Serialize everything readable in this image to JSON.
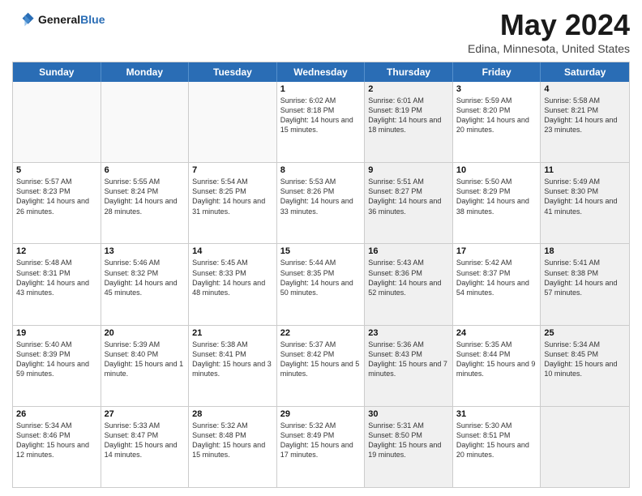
{
  "header": {
    "logo_general": "General",
    "logo_blue": "Blue",
    "month_title": "May 2024",
    "location": "Edina, Minnesota, United States"
  },
  "days_of_week": [
    "Sunday",
    "Monday",
    "Tuesday",
    "Wednesday",
    "Thursday",
    "Friday",
    "Saturday"
  ],
  "weeks": [
    [
      {
        "day": "",
        "sunrise": "",
        "sunset": "",
        "daylight": "",
        "shaded": false,
        "empty": true
      },
      {
        "day": "",
        "sunrise": "",
        "sunset": "",
        "daylight": "",
        "shaded": false,
        "empty": true
      },
      {
        "day": "",
        "sunrise": "",
        "sunset": "",
        "daylight": "",
        "shaded": false,
        "empty": true
      },
      {
        "day": "1",
        "sunrise": "Sunrise: 6:02 AM",
        "sunset": "Sunset: 8:18 PM",
        "daylight": "Daylight: 14 hours and 15 minutes.",
        "shaded": false,
        "empty": false
      },
      {
        "day": "2",
        "sunrise": "Sunrise: 6:01 AM",
        "sunset": "Sunset: 8:19 PM",
        "daylight": "Daylight: 14 hours and 18 minutes.",
        "shaded": true,
        "empty": false
      },
      {
        "day": "3",
        "sunrise": "Sunrise: 5:59 AM",
        "sunset": "Sunset: 8:20 PM",
        "daylight": "Daylight: 14 hours and 20 minutes.",
        "shaded": false,
        "empty": false
      },
      {
        "day": "4",
        "sunrise": "Sunrise: 5:58 AM",
        "sunset": "Sunset: 8:21 PM",
        "daylight": "Daylight: 14 hours and 23 minutes.",
        "shaded": true,
        "empty": false
      }
    ],
    [
      {
        "day": "5",
        "sunrise": "Sunrise: 5:57 AM",
        "sunset": "Sunset: 8:23 PM",
        "daylight": "Daylight: 14 hours and 26 minutes.",
        "shaded": false,
        "empty": false
      },
      {
        "day": "6",
        "sunrise": "Sunrise: 5:55 AM",
        "sunset": "Sunset: 8:24 PM",
        "daylight": "Daylight: 14 hours and 28 minutes.",
        "shaded": false,
        "empty": false
      },
      {
        "day": "7",
        "sunrise": "Sunrise: 5:54 AM",
        "sunset": "Sunset: 8:25 PM",
        "daylight": "Daylight: 14 hours and 31 minutes.",
        "shaded": false,
        "empty": false
      },
      {
        "day": "8",
        "sunrise": "Sunrise: 5:53 AM",
        "sunset": "Sunset: 8:26 PM",
        "daylight": "Daylight: 14 hours and 33 minutes.",
        "shaded": false,
        "empty": false
      },
      {
        "day": "9",
        "sunrise": "Sunrise: 5:51 AM",
        "sunset": "Sunset: 8:27 PM",
        "daylight": "Daylight: 14 hours and 36 minutes.",
        "shaded": true,
        "empty": false
      },
      {
        "day": "10",
        "sunrise": "Sunrise: 5:50 AM",
        "sunset": "Sunset: 8:29 PM",
        "daylight": "Daylight: 14 hours and 38 minutes.",
        "shaded": false,
        "empty": false
      },
      {
        "day": "11",
        "sunrise": "Sunrise: 5:49 AM",
        "sunset": "Sunset: 8:30 PM",
        "daylight": "Daylight: 14 hours and 41 minutes.",
        "shaded": true,
        "empty": false
      }
    ],
    [
      {
        "day": "12",
        "sunrise": "Sunrise: 5:48 AM",
        "sunset": "Sunset: 8:31 PM",
        "daylight": "Daylight: 14 hours and 43 minutes.",
        "shaded": false,
        "empty": false
      },
      {
        "day": "13",
        "sunrise": "Sunrise: 5:46 AM",
        "sunset": "Sunset: 8:32 PM",
        "daylight": "Daylight: 14 hours and 45 minutes.",
        "shaded": false,
        "empty": false
      },
      {
        "day": "14",
        "sunrise": "Sunrise: 5:45 AM",
        "sunset": "Sunset: 8:33 PM",
        "daylight": "Daylight: 14 hours and 48 minutes.",
        "shaded": false,
        "empty": false
      },
      {
        "day": "15",
        "sunrise": "Sunrise: 5:44 AM",
        "sunset": "Sunset: 8:35 PM",
        "daylight": "Daylight: 14 hours and 50 minutes.",
        "shaded": false,
        "empty": false
      },
      {
        "day": "16",
        "sunrise": "Sunrise: 5:43 AM",
        "sunset": "Sunset: 8:36 PM",
        "daylight": "Daylight: 14 hours and 52 minutes.",
        "shaded": true,
        "empty": false
      },
      {
        "day": "17",
        "sunrise": "Sunrise: 5:42 AM",
        "sunset": "Sunset: 8:37 PM",
        "daylight": "Daylight: 14 hours and 54 minutes.",
        "shaded": false,
        "empty": false
      },
      {
        "day": "18",
        "sunrise": "Sunrise: 5:41 AM",
        "sunset": "Sunset: 8:38 PM",
        "daylight": "Daylight: 14 hours and 57 minutes.",
        "shaded": true,
        "empty": false
      }
    ],
    [
      {
        "day": "19",
        "sunrise": "Sunrise: 5:40 AM",
        "sunset": "Sunset: 8:39 PM",
        "daylight": "Daylight: 14 hours and 59 minutes.",
        "shaded": false,
        "empty": false
      },
      {
        "day": "20",
        "sunrise": "Sunrise: 5:39 AM",
        "sunset": "Sunset: 8:40 PM",
        "daylight": "Daylight: 15 hours and 1 minute.",
        "shaded": false,
        "empty": false
      },
      {
        "day": "21",
        "sunrise": "Sunrise: 5:38 AM",
        "sunset": "Sunset: 8:41 PM",
        "daylight": "Daylight: 15 hours and 3 minutes.",
        "shaded": false,
        "empty": false
      },
      {
        "day": "22",
        "sunrise": "Sunrise: 5:37 AM",
        "sunset": "Sunset: 8:42 PM",
        "daylight": "Daylight: 15 hours and 5 minutes.",
        "shaded": false,
        "empty": false
      },
      {
        "day": "23",
        "sunrise": "Sunrise: 5:36 AM",
        "sunset": "Sunset: 8:43 PM",
        "daylight": "Daylight: 15 hours and 7 minutes.",
        "shaded": true,
        "empty": false
      },
      {
        "day": "24",
        "sunrise": "Sunrise: 5:35 AM",
        "sunset": "Sunset: 8:44 PM",
        "daylight": "Daylight: 15 hours and 9 minutes.",
        "shaded": false,
        "empty": false
      },
      {
        "day": "25",
        "sunrise": "Sunrise: 5:34 AM",
        "sunset": "Sunset: 8:45 PM",
        "daylight": "Daylight: 15 hours and 10 minutes.",
        "shaded": true,
        "empty": false
      }
    ],
    [
      {
        "day": "26",
        "sunrise": "Sunrise: 5:34 AM",
        "sunset": "Sunset: 8:46 PM",
        "daylight": "Daylight: 15 hours and 12 minutes.",
        "shaded": false,
        "empty": false
      },
      {
        "day": "27",
        "sunrise": "Sunrise: 5:33 AM",
        "sunset": "Sunset: 8:47 PM",
        "daylight": "Daylight: 15 hours and 14 minutes.",
        "shaded": false,
        "empty": false
      },
      {
        "day": "28",
        "sunrise": "Sunrise: 5:32 AM",
        "sunset": "Sunset: 8:48 PM",
        "daylight": "Daylight: 15 hours and 15 minutes.",
        "shaded": false,
        "empty": false
      },
      {
        "day": "29",
        "sunrise": "Sunrise: 5:32 AM",
        "sunset": "Sunset: 8:49 PM",
        "daylight": "Daylight: 15 hours and 17 minutes.",
        "shaded": false,
        "empty": false
      },
      {
        "day": "30",
        "sunrise": "Sunrise: 5:31 AM",
        "sunset": "Sunset: 8:50 PM",
        "daylight": "Daylight: 15 hours and 19 minutes.",
        "shaded": true,
        "empty": false
      },
      {
        "day": "31",
        "sunrise": "Sunrise: 5:30 AM",
        "sunset": "Sunset: 8:51 PM",
        "daylight": "Daylight: 15 hours and 20 minutes.",
        "shaded": false,
        "empty": false
      },
      {
        "day": "",
        "sunrise": "",
        "sunset": "",
        "daylight": "",
        "shaded": true,
        "empty": true
      }
    ]
  ]
}
